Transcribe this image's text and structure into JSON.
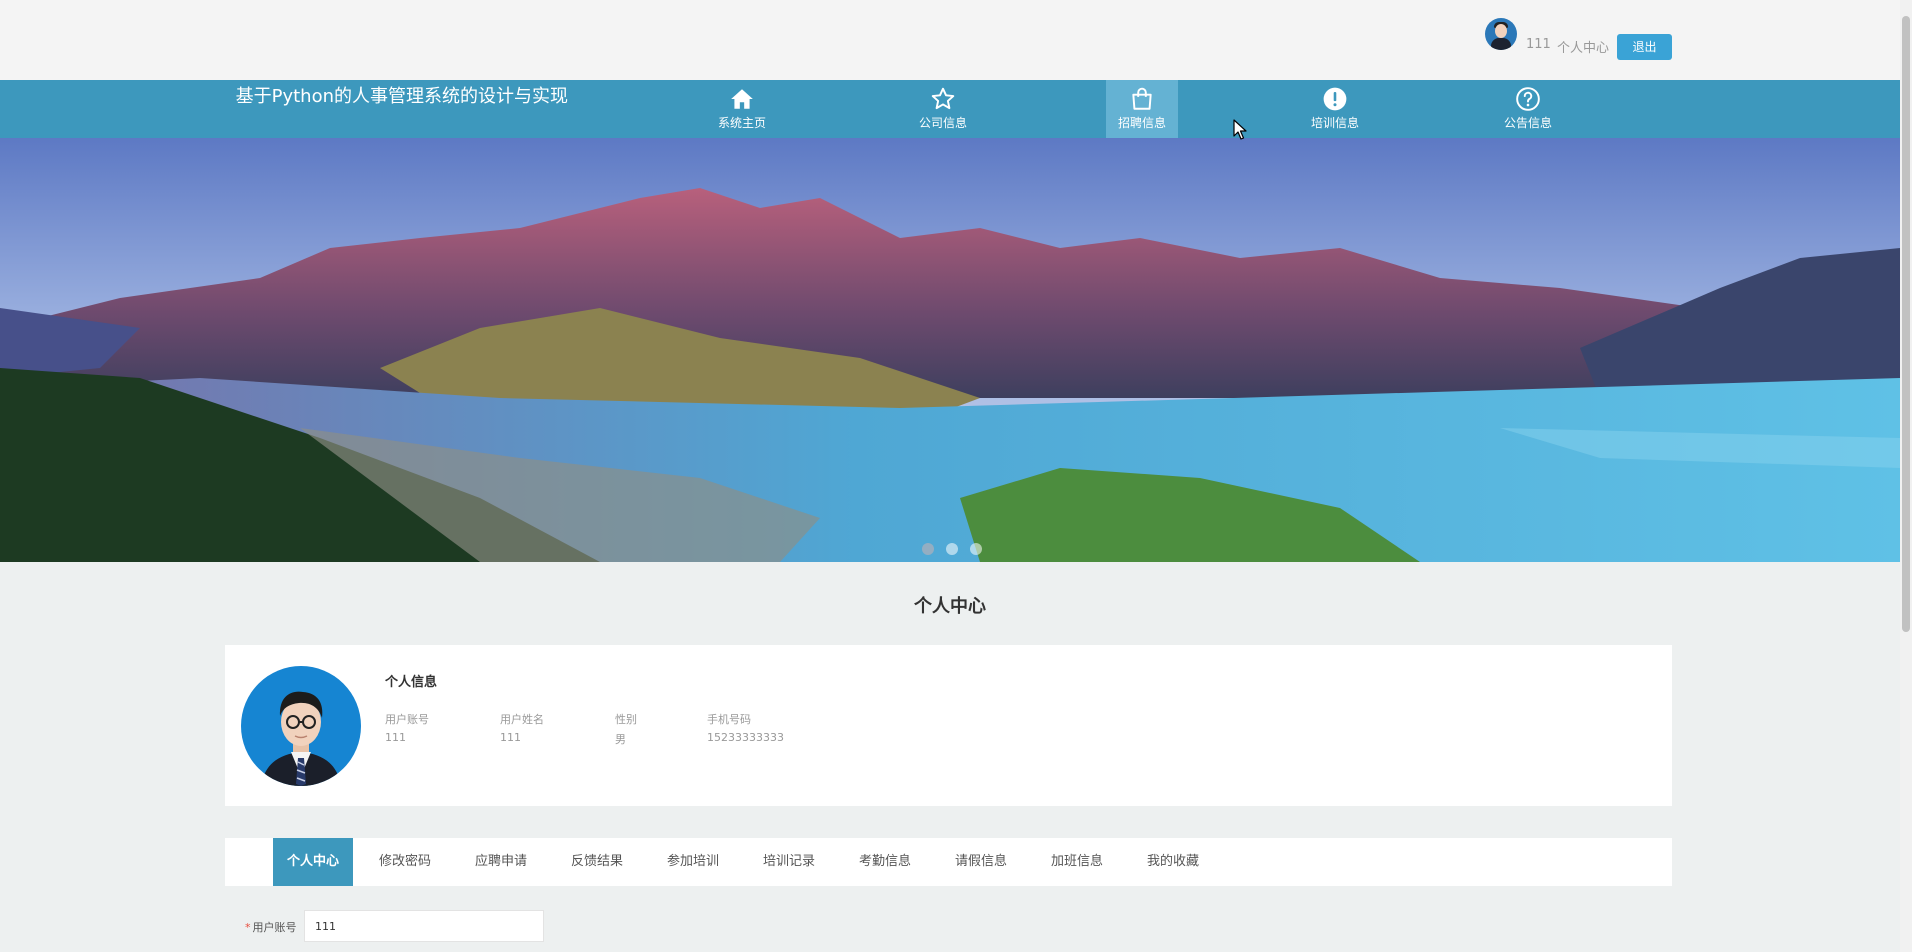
{
  "header": {
    "username": "111",
    "user_center_label": "个人中心",
    "logout_label": "退出"
  },
  "nav": {
    "site_title": "基于Python的人事管理系统的设计与实现",
    "items": [
      {
        "label": "系统主页",
        "icon": "home-icon"
      },
      {
        "label": "公司信息",
        "icon": "star-icon"
      },
      {
        "label": "招聘信息",
        "icon": "shopping-bag-icon",
        "active": true
      },
      {
        "label": "培训信息",
        "icon": "exclamation-circle-icon"
      },
      {
        "label": "公告信息",
        "icon": "question-circle-icon"
      }
    ]
  },
  "banner": {
    "slide_count": 3,
    "active_slide": 1
  },
  "page": {
    "title": "个人中心"
  },
  "profile": {
    "heading": "个人信息",
    "fields": [
      {
        "label": "用户账号",
        "value": "111"
      },
      {
        "label": "用户姓名",
        "value": "111"
      },
      {
        "label": "性别",
        "value": "男"
      },
      {
        "label": "手机号码",
        "value": "15233333333"
      }
    ]
  },
  "tabs": [
    {
      "label": "个人中心",
      "active": true
    },
    {
      "label": "修改密码"
    },
    {
      "label": "应聘申请"
    },
    {
      "label": "反馈结果"
    },
    {
      "label": "参加培训"
    },
    {
      "label": "培训记录"
    },
    {
      "label": "考勤信息"
    },
    {
      "label": "请假信息"
    },
    {
      "label": "加班信息"
    },
    {
      "label": "我的收藏"
    }
  ],
  "form": {
    "account_label": "用户账号",
    "required_mark": "*",
    "account_value": "111"
  },
  "colors": {
    "nav_bg": "#3d98bd",
    "nav_active": "#64b2d3",
    "logout_btn": "#3aa3d6",
    "page_bg": "#edf0f0"
  }
}
